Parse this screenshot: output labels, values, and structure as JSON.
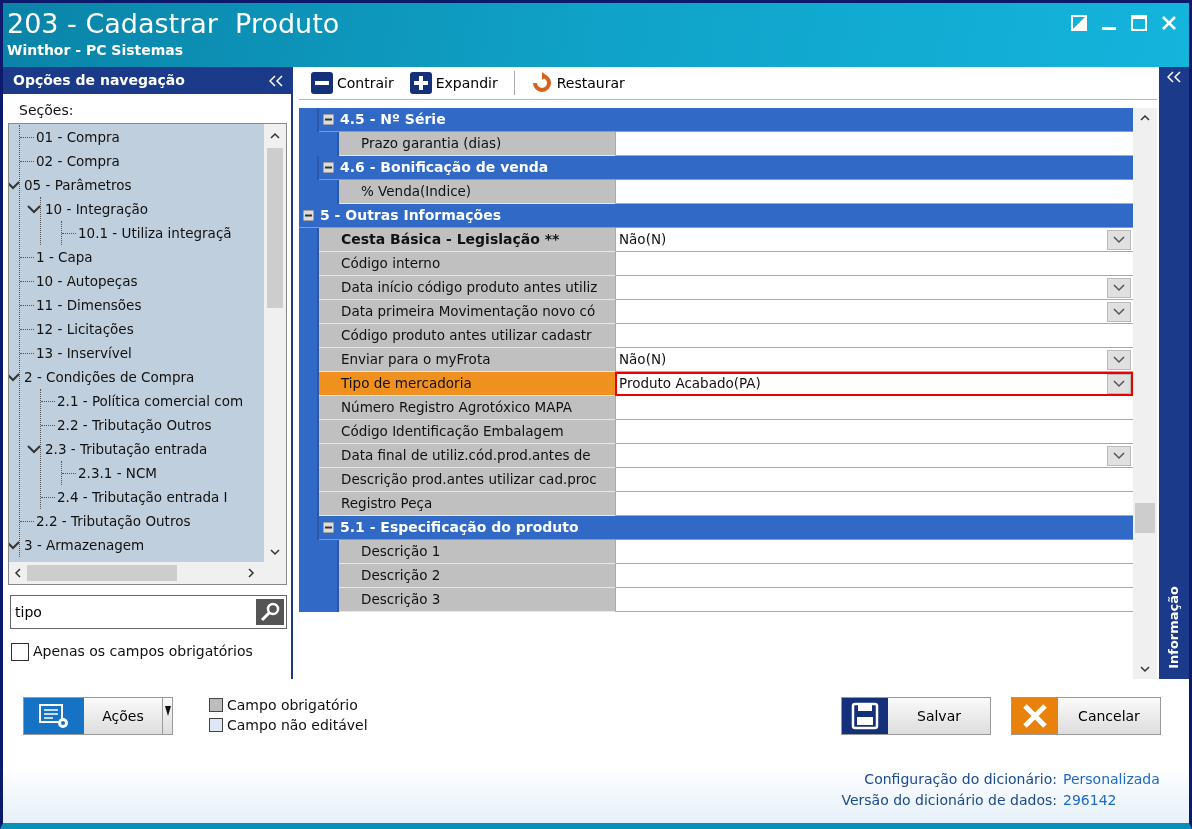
{
  "window": {
    "title": "203 - Cadastrar  Produto",
    "subtitle": "Winthor - PC Sistemas"
  },
  "nav": {
    "title": "Opções de navegação",
    "sections_label": "Seções:",
    "tree": [
      {
        "label": "01 - Compra"
      },
      {
        "label": "02 - Compra"
      },
      {
        "label": "05 - Parâmetros",
        "expanded": true,
        "children": [
          {
            "label": "10 - Integração",
            "expanded": true,
            "children": [
              {
                "label": "10.1 - Utiliza integraçã"
              }
            ]
          }
        ]
      },
      {
        "label": "1 - Capa"
      },
      {
        "label": "10 - Autopeças"
      },
      {
        "label": "11 - Dimensões"
      },
      {
        "label": "12 - Licitações"
      },
      {
        "label": "13 - Inservível"
      },
      {
        "label": "2 - Condições de Compra",
        "expanded": true,
        "children": [
          {
            "label": "2.1 - Política comercial com"
          },
          {
            "label": "2.2 - Tributação Outros"
          },
          {
            "label": "2.3 - Tributação entrada",
            "expanded": true,
            "children": [
              {
                "label": "2.3.1 - NCM"
              }
            ]
          },
          {
            "label": "2.4 - Tributação entrada I"
          }
        ]
      },
      {
        "label": "2.2 - Tributação Outros"
      },
      {
        "label": "3 - Armazenagem",
        "expanded": true
      }
    ],
    "search": {
      "value": "tipo"
    },
    "required_only": {
      "label": "Apenas os campos obrigatórios",
      "checked": false
    }
  },
  "toolbar": [
    {
      "kind": "contract",
      "label": "Contrair"
    },
    {
      "kind": "expand",
      "label": "Expandir"
    },
    {
      "kind": "restore",
      "label": "Restaurar"
    }
  ],
  "grid": {
    "groups": [
      {
        "children": [
          {
            "title": "4.5 - Nº Série",
            "fields": [
              {
                "label": "Prazo garantia (dias)",
                "dropdown": false,
                "required": false,
                "selected": false
              }
            ]
          },
          {
            "title": "4.6 - Bonificação de venda",
            "fields": [
              {
                "label": "% Venda(Indice)",
                "dropdown": false,
                "required": false,
                "selected": false
              }
            ]
          }
        ]
      },
      {
        "title": "5 - Outras Informações",
        "fields": [
          {
            "label": "Cesta Básica - Legislação **",
            "value": "Não(N)",
            "dropdown": true,
            "required": true,
            "selected": false
          },
          {
            "label": "Código interno",
            "dropdown": false,
            "required": false,
            "selected": false
          },
          {
            "label": "Data início código produto antes utiliz",
            "dropdown": true,
            "required": false,
            "selected": false
          },
          {
            "label": "Data primeira Movimentação novo có",
            "dropdown": true,
            "required": false,
            "selected": false
          },
          {
            "label": "Código produto antes utilizar cadastr",
            "dropdown": false,
            "required": false,
            "selected": false
          },
          {
            "label": "Enviar para o myFrota",
            "value": "Não(N)",
            "dropdown": true,
            "required": false,
            "selected": false
          },
          {
            "label": "Tipo de mercadoria",
            "value": "Produto Acabado(PA)",
            "dropdown": true,
            "required": false,
            "selected": true,
            "highlighted": true
          },
          {
            "label": "Número Registro Agrotóxico MAPA",
            "dropdown": false,
            "required": false,
            "selected": false
          },
          {
            "label": "Código Identificação Embalagem",
            "dropdown": false,
            "required": false,
            "selected": false
          },
          {
            "label": "Data final de utiliz.cód.prod.antes de",
            "dropdown": true,
            "required": false,
            "selected": false
          },
          {
            "label": "Descrição prod.antes utilizar cad.proc",
            "dropdown": false,
            "required": false,
            "selected": false
          },
          {
            "label": "Registro Peça",
            "dropdown": false,
            "required": false,
            "selected": false
          }
        ],
        "children": [
          {
            "title": "5.1 - Especificação do produto",
            "fields": [
              {
                "label": "Descrição 1",
                "dropdown": false,
                "required": false,
                "selected": false
              },
              {
                "label": "Descrição 2",
                "dropdown": false,
                "required": false,
                "selected": false
              },
              {
                "label": "Descrição 3",
                "dropdown": false,
                "required": false,
                "selected": false
              }
            ]
          }
        ]
      }
    ]
  },
  "info_panel": {
    "label": "Informação"
  },
  "actions_button": {
    "label": "Ações"
  },
  "legend": [
    {
      "kind": "required",
      "label": "Campo obrigatório"
    },
    {
      "kind": "readonly",
      "label": "Campo não editável"
    }
  ],
  "buttons": [
    {
      "kind": "save",
      "label": "Salvar"
    },
    {
      "kind": "cancel",
      "label": "Cancelar"
    }
  ],
  "footer": [
    {
      "label": "Configuração do dicionário:",
      "value": "Personalizada"
    },
    {
      "label": "Versão do dicionário de dados:",
      "value": "296142"
    }
  ]
}
